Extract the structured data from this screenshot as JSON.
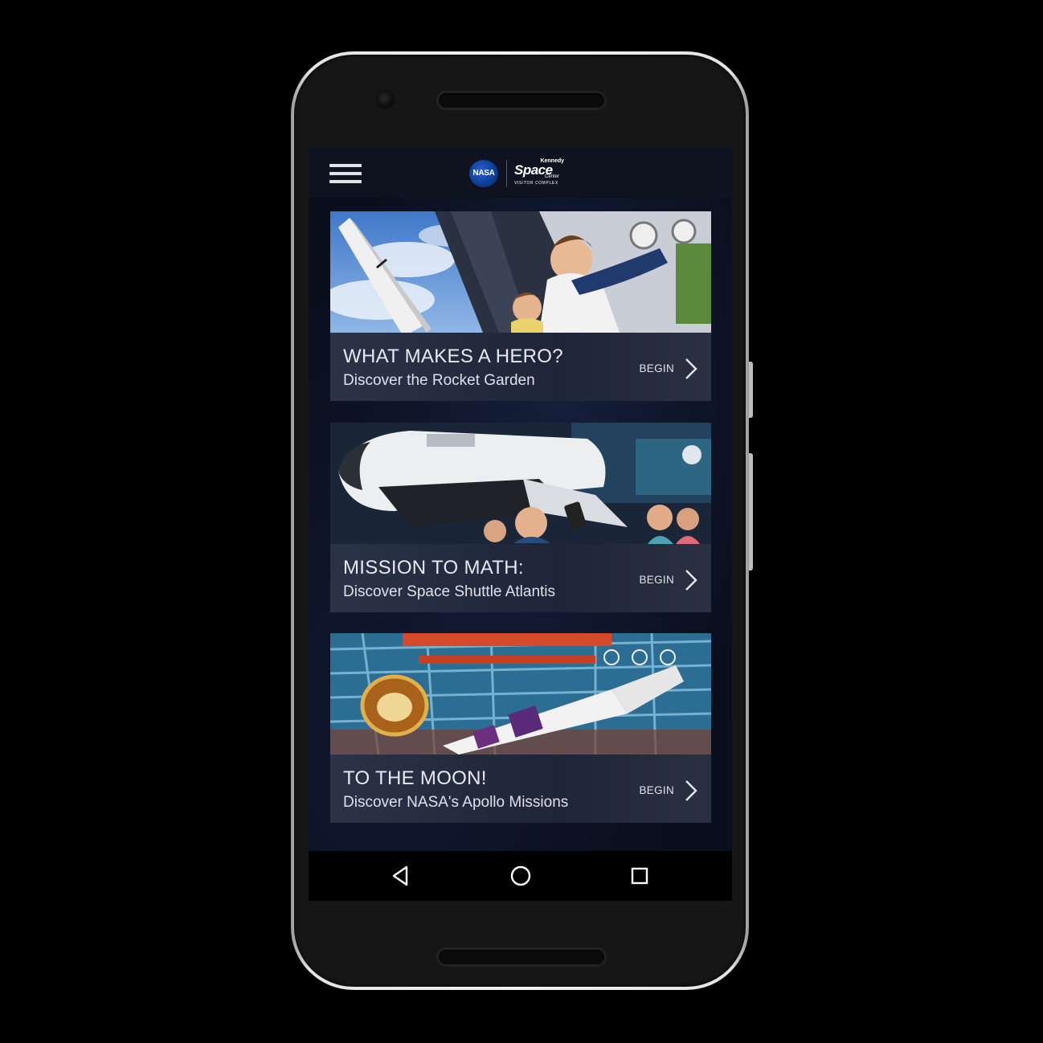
{
  "header": {
    "menu_icon": "hamburger-menu-icon",
    "logo": {
      "nasa_text": "NASA",
      "ksc_kennedy": "Kennedy",
      "ksc_space": "Space",
      "ksc_center": "Center",
      "ksc_visitor": "VISITOR COMPLEX"
    }
  },
  "cards": [
    {
      "title": "WHAT MAKES A HERO?",
      "subtitle": "Discover the Rocket Garden",
      "action": "BEGIN"
    },
    {
      "title": "MISSION TO MATH:",
      "subtitle": "Discover Space Shuttle Atlantis",
      "action": "BEGIN"
    },
    {
      "title": "TO THE MOON!",
      "subtitle": "Discover NASA's Apollo Missions",
      "action": "BEGIN"
    }
  ],
  "navbar": {
    "back_icon": "back-triangle-icon",
    "home_icon": "home-circle-icon",
    "recents_icon": "recents-square-icon"
  },
  "colors": {
    "screen_bg": "#0a0f1e",
    "card_footer": "#232b3e",
    "text": "#e6e9f0"
  }
}
